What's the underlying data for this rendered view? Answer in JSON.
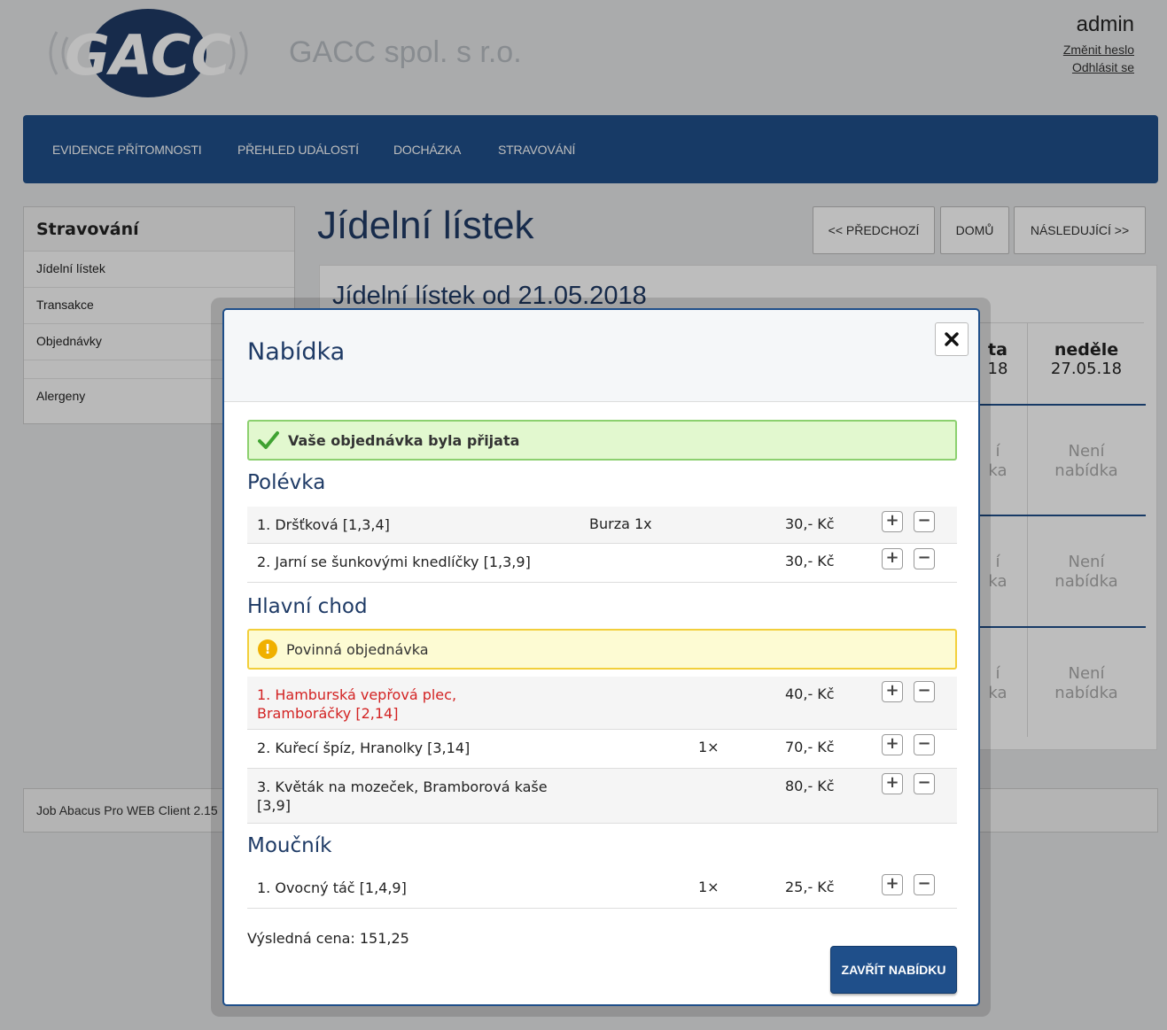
{
  "header": {
    "logo_text": "GACC",
    "company_name": "GACC spol. s r.o.",
    "user": "admin",
    "change_password": "Změnit heslo",
    "logout": "Odhlásit se"
  },
  "nav": {
    "items": [
      "EVIDENCE PŘÍTOMNOSTI",
      "PŘEHLED UDÁLOSTÍ",
      "DOCHÁZKA",
      "STRAVOVÁNÍ"
    ]
  },
  "sidebar": {
    "title": "Stravování",
    "items": [
      "Jídelní lístek",
      "Transakce",
      "Objednávky",
      "Alergeny"
    ]
  },
  "main": {
    "title": "Jídelní lístek",
    "prev_button": "<< PŘEDCHOZÍ",
    "home_button": "DOMŮ",
    "next_button": "NÁSLEDUJÍCÍ >>",
    "panel_title": "Jídelní lístek od 21.05.2018",
    "partial_day_label": "ta",
    "partial_day_date": "18",
    "partial_cell_1": "í",
    "partial_cell_2": "ka",
    "last_day_label": "neděle",
    "last_day_date": "27.05.18",
    "no_offer_line1": "Není",
    "no_offer_line2": "nabídka"
  },
  "footer": {
    "text": "Job Abacus Pro WEB Client 2.15"
  },
  "modal": {
    "title": "Nabídka",
    "success_message": "Vaše objednávka byla přijata",
    "warning_message": "Povinná objednávka",
    "sections": [
      {
        "title": "Polévka",
        "items": [
          {
            "name": "1. Dršťková [1,3,4]",
            "note": "Burza 1x",
            "price": "30,- Kč"
          },
          {
            "name": "2. Jarní se šunkovými knedlíčky [1,3,9]",
            "note": "",
            "price": "30,- Kč"
          }
        ]
      },
      {
        "title": "Hlavní chod",
        "items": [
          {
            "name": "1. Hamburská vepřová plec, Bramboráčky [2,14]",
            "note": "",
            "price": "40,- Kč"
          },
          {
            "name": "2. Kuřecí špíz, Hranolky [3,14]",
            "note": "1×",
            "price": "70,- Kč"
          },
          {
            "name": "3. Květák na mozeček, Bramborová kaše [3,9]",
            "note": "",
            "price": "80,- Kč"
          }
        ]
      },
      {
        "title": "Moučník",
        "items": [
          {
            "name": "1. Ovocný táč [1,4,9]",
            "note": "1×",
            "price": "25,- Kč"
          }
        ]
      }
    ],
    "plus_symbol": "+",
    "minus_symbol": "−",
    "total": "Výsledná cena: 151,25",
    "close_offer_button": "ZAVŘÍT NABÍDKU"
  },
  "colors": {
    "brand": "#1f4f8a",
    "heading": "#1f3b66",
    "success_bg": "#e2f8cf",
    "warning_bg": "#fdfbd3",
    "error_text": "#d32323"
  }
}
